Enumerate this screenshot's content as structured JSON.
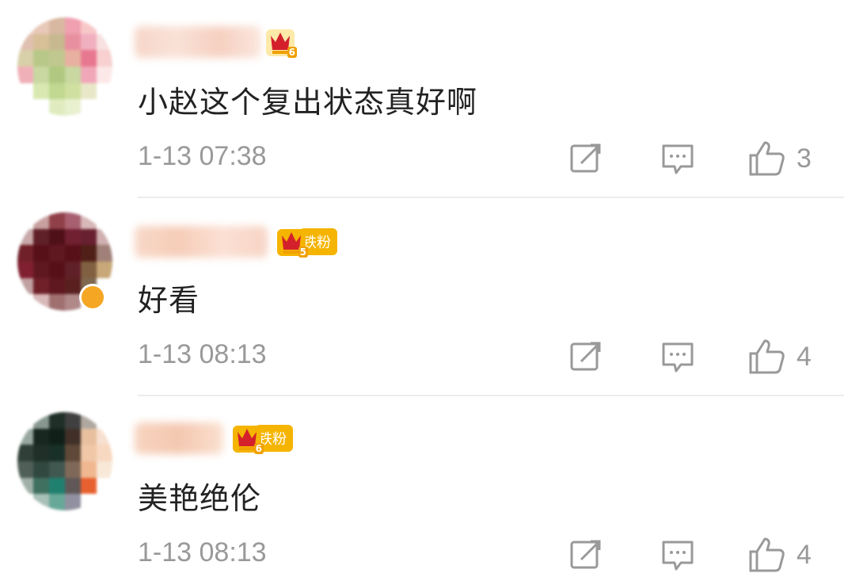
{
  "comments": [
    {
      "level": "6",
      "fan_badge": "",
      "text": "小赵这个复出状态真好啊",
      "time": "1-13 07:38",
      "likes": "3",
      "icons": [
        "repost-icon",
        "comment-icon",
        "like-icon"
      ]
    },
    {
      "level": "5",
      "fan_badge": "铁粉",
      "text": "好看",
      "time": "1-13 08:13",
      "likes": "4",
      "icons": [
        "repost-icon",
        "comment-icon",
        "like-icon"
      ]
    },
    {
      "level": "6",
      "fan_badge": "铁粉",
      "text": "美艳绝伦",
      "time": "1-13 08:13",
      "likes": "4",
      "icons": [
        "repost-icon",
        "comment-icon",
        "like-icon"
      ]
    }
  ],
  "colors": {
    "badge": "#f5b400",
    "crown": "#d4202b",
    "muted": "#999999",
    "divider": "#ececec"
  }
}
